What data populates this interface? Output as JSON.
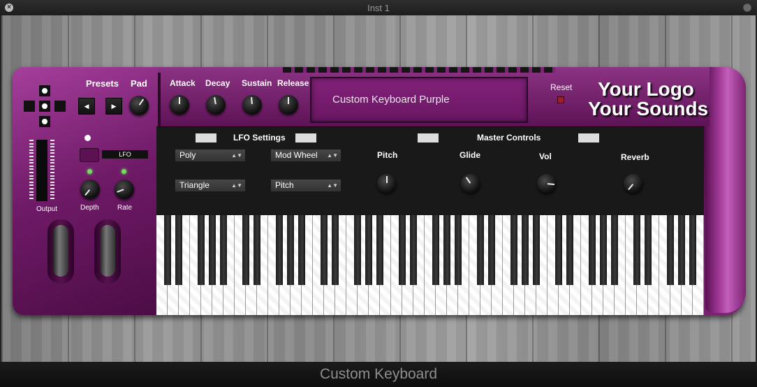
{
  "window": {
    "title": "Inst 1",
    "footer_title": "Custom Keyboard"
  },
  "header": {
    "presets_label": "Presets",
    "pad_label": "Pad",
    "prev_icon": "◀",
    "next_icon": "▶",
    "adsr": [
      "Attack",
      "Decay",
      "Sustain",
      "Release"
    ],
    "display_text": "Custom Keyboard Purple",
    "reset_label": "Reset",
    "logo_line1": "Your Logo",
    "logo_line2": "Your Sounds"
  },
  "left": {
    "output_label": "Output",
    "lfo_label": "LFO",
    "depth_label": "Depth",
    "rate_label": "Rate"
  },
  "panel": {
    "lfo_settings": "LFO Settings",
    "master_controls": "Master Controls",
    "mode_select": "Poly",
    "wave_select": "Triangle",
    "source_select": "Mod Wheel",
    "dest_select": "Pitch",
    "master_knobs": [
      "Pitch",
      "Glide",
      "Vol",
      "Reverb"
    ]
  },
  "icons": [
    "close-icon",
    "zoom-icon",
    "chevron-left-icon",
    "chevron-right-icon",
    "dpad-icon",
    "dropdown-arrow-icon"
  ],
  "colors": {
    "accent": "#7a1f70",
    "panel": "#191919",
    "led": "#6fdf5e"
  }
}
